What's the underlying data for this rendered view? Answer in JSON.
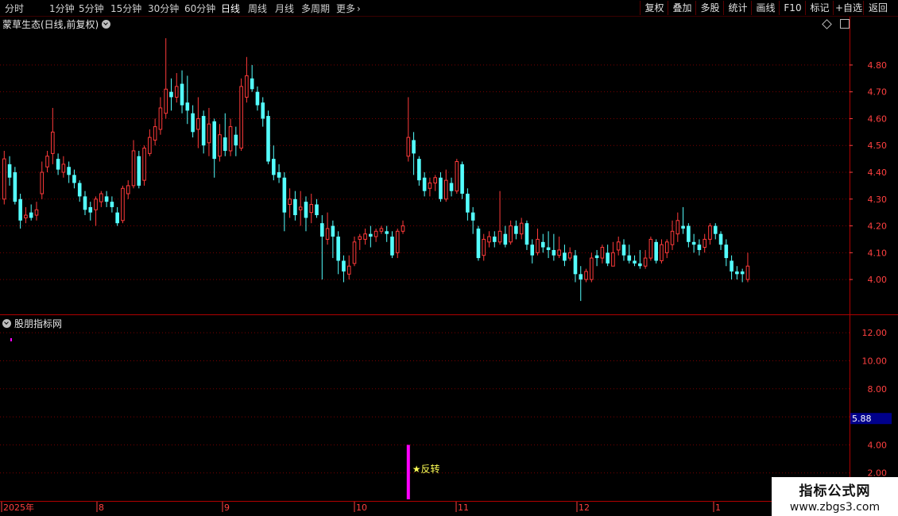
{
  "toolbar": {
    "periods": [
      "分时",
      "1分钟",
      "5分钟",
      "15分钟",
      "30分钟",
      "60分钟",
      "日线",
      "周线",
      "月线",
      "多周期",
      "更多"
    ],
    "active_period": "日线",
    "right_buttons": [
      "复权",
      "叠加",
      "多股",
      "统计",
      "画线",
      "F10",
      "标记",
      "+自选",
      "返回"
    ]
  },
  "stock_title": "蒙草生态(日线,前复权)",
  "indicator_title": "股朋指标网",
  "signal_label": "★反转",
  "value_badge": "5.88",
  "watermark": {
    "line1": "指标公式网",
    "line2": "www.zbgs3.com"
  },
  "colors": {
    "up": "#ff3a3a",
    "down": "#54ffff",
    "signal": "#ff00ff",
    "axis": "#ff4040",
    "grid": "#7a0000"
  },
  "chart_data": [
    {
      "type": "candlestick",
      "price_axis_ticks": [
        "4.80",
        "4.70",
        "4.60",
        "4.50",
        "4.40",
        "4.30",
        "4.20",
        "4.10",
        "4.00"
      ],
      "ylim": [
        3.87,
        4.93
      ],
      "x_axis_labels": [
        "2025年",
        "8",
        "9",
        "10",
        "11",
        "12",
        "1"
      ],
      "candles": [
        [
          4.3,
          4.45,
          4.48,
          4.28
        ],
        [
          4.43,
          4.38,
          4.46,
          4.35
        ],
        [
          4.4,
          4.29,
          4.42,
          4.28
        ],
        [
          4.3,
          4.22,
          4.32,
          4.19
        ],
        [
          4.23,
          4.24,
          4.27,
          4.21
        ],
        [
          4.25,
          4.23,
          4.28,
          4.22
        ],
        [
          4.24,
          4.26,
          4.29,
          4.22
        ],
        [
          4.32,
          4.4,
          4.44,
          4.3
        ],
        [
          4.42,
          4.46,
          4.48,
          4.4
        ],
        [
          4.47,
          4.55,
          4.64,
          4.43
        ],
        [
          4.45,
          4.41,
          4.47,
          4.39
        ],
        [
          4.4,
          4.43,
          4.46,
          4.38
        ],
        [
          4.42,
          4.39,
          4.44,
          4.36
        ],
        [
          4.39,
          4.36,
          4.41,
          4.34
        ],
        [
          4.36,
          4.31,
          4.37,
          4.29
        ],
        [
          4.31,
          4.26,
          4.33,
          4.24
        ],
        [
          4.27,
          4.25,
          4.29,
          4.22
        ],
        [
          4.26,
          4.3,
          4.31,
          4.2
        ],
        [
          4.29,
          4.32,
          4.33,
          4.27
        ],
        [
          4.31,
          4.29,
          4.33,
          4.27
        ],
        [
          4.29,
          4.27,
          4.31,
          4.25
        ],
        [
          4.25,
          4.21,
          4.27,
          4.2
        ],
        [
          4.22,
          4.34,
          4.35,
          4.21
        ],
        [
          4.32,
          4.35,
          4.37,
          4.3
        ],
        [
          4.35,
          4.48,
          4.52,
          4.34
        ],
        [
          4.46,
          4.35,
          4.48,
          4.34
        ],
        [
          4.37,
          4.49,
          4.5,
          4.35
        ],
        [
          4.47,
          4.53,
          4.56,
          4.46
        ],
        [
          4.52,
          4.57,
          4.6,
          4.5
        ],
        [
          4.56,
          4.64,
          4.68,
          4.54
        ],
        [
          4.62,
          4.71,
          4.9,
          4.6
        ],
        [
          4.7,
          4.68,
          4.75,
          4.63
        ],
        [
          4.68,
          4.72,
          4.77,
          4.66
        ],
        [
          4.73,
          4.65,
          4.78,
          4.62
        ],
        [
          4.66,
          4.63,
          4.76,
          4.58
        ],
        [
          4.62,
          4.55,
          4.65,
          4.53
        ],
        [
          4.56,
          4.6,
          4.68,
          4.49
        ],
        [
          4.61,
          4.5,
          4.63,
          4.47
        ],
        [
          4.51,
          4.58,
          4.64,
          4.46
        ],
        [
          4.59,
          4.45,
          4.6,
          4.38
        ],
        [
          4.46,
          4.54,
          4.58,
          4.44
        ],
        [
          4.53,
          4.48,
          4.62,
          4.46
        ],
        [
          4.48,
          4.57,
          4.6,
          4.46
        ],
        [
          4.54,
          4.5,
          4.57,
          4.46
        ],
        [
          4.49,
          4.72,
          4.75,
          4.48
        ],
        [
          4.68,
          4.76,
          4.83,
          4.66
        ],
        [
          4.75,
          4.71,
          4.8,
          4.7
        ],
        [
          4.7,
          4.65,
          4.72,
          4.63
        ],
        [
          4.66,
          4.6,
          4.68,
          4.57
        ],
        [
          4.61,
          4.44,
          4.63,
          4.43
        ],
        [
          4.45,
          4.39,
          4.5,
          4.37
        ],
        [
          4.4,
          4.38,
          4.43,
          4.36
        ],
        [
          4.38,
          4.25,
          4.4,
          4.18
        ],
        [
          4.28,
          4.3,
          4.34,
          4.23
        ],
        [
          4.3,
          4.24,
          4.33,
          4.22
        ],
        [
          4.26,
          4.27,
          4.33,
          4.2
        ],
        [
          4.29,
          4.23,
          4.31,
          4.18
        ],
        [
          4.25,
          4.28,
          4.32,
          4.21
        ],
        [
          4.28,
          4.24,
          4.3,
          4.23
        ],
        [
          4.21,
          4.16,
          4.24,
          4.0
        ],
        [
          4.15,
          4.19,
          4.25,
          4.13
        ],
        [
          4.2,
          4.16,
          4.22,
          4.08
        ],
        [
          4.16,
          4.07,
          4.18,
          4.02
        ],
        [
          4.07,
          4.03,
          4.09,
          3.99
        ],
        [
          4.02,
          4.05,
          4.09,
          4.0
        ],
        [
          4.06,
          4.14,
          4.16,
          4.05
        ],
        [
          4.15,
          4.16,
          4.17,
          4.11
        ],
        [
          4.15,
          4.17,
          4.19,
          4.13
        ],
        [
          4.17,
          4.16,
          4.2,
          4.12
        ],
        [
          4.16,
          4.18,
          4.19,
          4.14
        ],
        [
          4.18,
          4.19,
          4.2,
          4.17
        ],
        [
          4.18,
          4.17,
          4.2,
          4.14
        ],
        [
          4.16,
          4.09,
          4.18,
          4.08
        ],
        [
          4.1,
          4.18,
          4.19,
          4.08
        ],
        [
          4.18,
          4.2,
          4.22,
          4.17
        ],
        [
          4.46,
          4.53,
          4.68,
          4.44
        ],
        [
          4.52,
          4.47,
          4.55,
          4.39
        ],
        [
          4.45,
          4.37,
          4.46,
          4.35
        ],
        [
          4.38,
          4.33,
          4.4,
          4.31
        ],
        [
          4.34,
          4.36,
          4.38,
          4.31
        ],
        [
          4.36,
          4.38,
          4.39,
          4.33
        ],
        [
          4.38,
          4.3,
          4.4,
          4.29
        ],
        [
          4.3,
          4.37,
          4.41,
          4.29
        ],
        [
          4.36,
          4.33,
          4.38,
          4.31
        ],
        [
          4.33,
          4.44,
          4.45,
          4.32
        ],
        [
          4.43,
          4.32,
          4.44,
          4.3
        ],
        [
          4.32,
          4.25,
          4.34,
          4.22
        ],
        [
          4.25,
          4.22,
          4.27,
          4.17
        ],
        [
          4.19,
          4.08,
          4.2,
          4.07
        ],
        [
          4.09,
          4.15,
          4.17,
          4.07
        ],
        [
          4.14,
          4.16,
          4.18,
          4.12
        ],
        [
          4.16,
          4.14,
          4.18,
          4.12
        ],
        [
          4.14,
          4.18,
          4.33,
          4.13
        ],
        [
          4.17,
          4.13,
          4.2,
          4.12
        ],
        [
          4.14,
          4.2,
          4.22,
          4.13
        ],
        [
          4.2,
          4.17,
          4.22,
          4.15
        ],
        [
          4.17,
          4.21,
          4.23,
          4.15
        ],
        [
          4.21,
          4.13,
          4.22,
          4.11
        ],
        [
          4.13,
          4.09,
          4.15,
          4.06
        ],
        [
          4.1,
          4.15,
          4.19,
          4.09
        ],
        [
          4.14,
          4.12,
          4.17,
          4.1
        ],
        [
          4.12,
          4.11,
          4.18,
          4.08
        ],
        [
          4.11,
          4.09,
          4.17,
          4.07
        ],
        [
          4.09,
          4.11,
          4.16,
          4.08
        ],
        [
          4.1,
          4.07,
          4.13,
          4.05
        ],
        [
          4.08,
          4.1,
          4.12,
          4.07
        ],
        [
          4.09,
          4.02,
          4.11,
          3.99
        ],
        [
          4.02,
          4.0,
          4.05,
          3.92
        ],
        [
          4.0,
          4.03,
          4.04,
          3.99
        ],
        [
          4.0,
          4.08,
          4.1,
          3.99
        ],
        [
          4.09,
          4.08,
          4.11,
          4.05
        ],
        [
          4.08,
          4.12,
          4.13,
          4.06
        ],
        [
          4.1,
          4.06,
          4.13,
          4.05
        ],
        [
          4.05,
          4.1,
          4.14,
          4.05
        ],
        [
          4.11,
          4.14,
          4.16,
          4.09
        ],
        [
          4.13,
          4.09,
          4.15,
          4.07
        ],
        [
          4.09,
          4.07,
          4.13,
          4.06
        ],
        [
          4.07,
          4.06,
          4.09,
          4.05
        ],
        [
          4.06,
          4.05,
          4.11,
          4.04
        ],
        [
          4.05,
          4.08,
          4.11,
          4.04
        ],
        [
          4.08,
          4.15,
          4.16,
          4.07
        ],
        [
          4.14,
          4.07,
          4.15,
          4.06
        ],
        [
          4.07,
          4.13,
          4.15,
          4.06
        ],
        [
          4.1,
          4.14,
          4.15,
          4.08
        ],
        [
          4.13,
          4.18,
          4.22,
          4.11
        ],
        [
          4.17,
          4.22,
          4.25,
          4.14
        ],
        [
          4.2,
          4.19,
          4.27,
          4.17
        ],
        [
          4.2,
          4.14,
          4.21,
          4.12
        ],
        [
          4.14,
          4.13,
          4.17,
          4.1
        ],
        [
          4.13,
          4.11,
          4.15,
          4.09
        ],
        [
          4.12,
          4.15,
          4.17,
          4.1
        ],
        [
          4.15,
          4.2,
          4.21,
          4.13
        ],
        [
          4.2,
          4.17,
          4.21,
          4.15
        ],
        [
          4.17,
          4.13,
          4.18,
          4.11
        ],
        [
          4.13,
          4.08,
          4.15,
          4.05
        ],
        [
          4.07,
          4.03,
          4.09,
          4.0
        ],
        [
          4.03,
          4.02,
          4.05,
          4.0
        ],
        [
          4.03,
          4.02,
          4.04,
          3.99
        ],
        [
          4.0,
          4.05,
          4.1,
          3.99
        ]
      ]
    },
    {
      "type": "bar",
      "y_axis_ticks": [
        "12.00",
        "10.00",
        "8.00",
        "6.00",
        "4.00",
        "2.00"
      ],
      "ylim": [
        0,
        13.2
      ],
      "signal_bar": {
        "index": 75,
        "value": 4
      },
      "marker_value": 5.88
    }
  ]
}
